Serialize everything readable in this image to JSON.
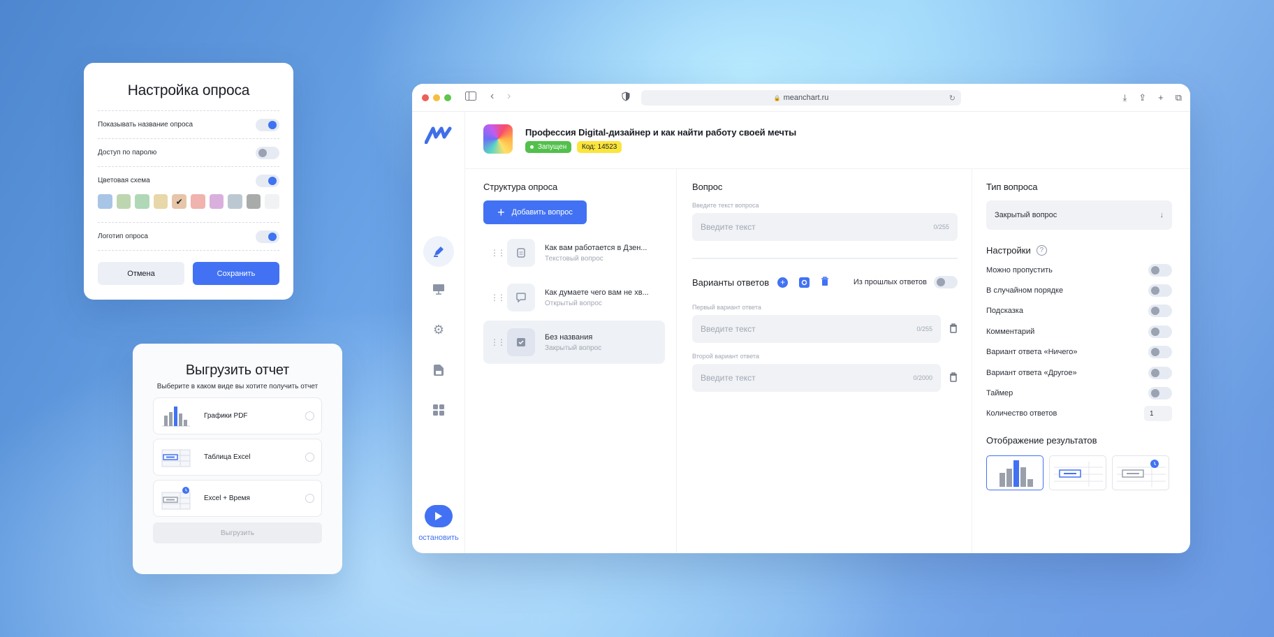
{
  "settings_card": {
    "title": "Настройка опроса",
    "rows": [
      {
        "label": "Показывать название опроса",
        "on": true
      },
      {
        "label": "Доступ по паролю",
        "on": false
      },
      {
        "label": "Цветовая схема",
        "on": true
      }
    ],
    "colors": [
      "#a8c5e6",
      "#bdd6b0",
      "#b0d8b7",
      "#e8d7a8",
      "#e6c5a8",
      "#f0b3ad",
      "#d9b0dd",
      "#bcc8d1",
      "#a9abab",
      "#f1f2f4"
    ],
    "selected_color_check": "✔",
    "logo_row": {
      "label": "Логотип опроса",
      "on": true
    },
    "cancel": "Отмена",
    "save": "Сохранить"
  },
  "export_card": {
    "title": "Выгрузить отчет",
    "subtitle": "Выберите в каком виде вы хотите получить отчет",
    "options": [
      "Графики PDF",
      "Таблица Excel",
      "Excel + Время"
    ],
    "download": "Выгрузить"
  },
  "browser": {
    "url": "meanchart.ru"
  },
  "survey": {
    "title": "Профессия Digital-дизайнер и как найти работу своей мечты",
    "status": "Запущен",
    "code": "Код: 14523",
    "stop": "остановить"
  },
  "structure": {
    "heading": "Структура опроса",
    "add_button": "Добавить вопрос",
    "questions": [
      {
        "title": "Как вам работается в Дзен...",
        "type": "Текстовый вопрос"
      },
      {
        "title": "Как думаете чего вам не хв...",
        "type": "Открытый вопрос"
      },
      {
        "title": "Без названия",
        "type": "Закрытый вопрос"
      }
    ]
  },
  "question": {
    "heading": "Вопрос",
    "field_label": "Введите текст вопроса",
    "placeholder": "Введите текст",
    "counter": "0/255",
    "answers_heading": "Варианты ответов",
    "from_past": "Из прошлых ответов",
    "answers": [
      {
        "label": "Первый вариант ответа",
        "placeholder": "Введите текст",
        "counter": "0/255"
      },
      {
        "label": "Второй вариант ответа",
        "placeholder": "Введите текст",
        "counter": "0/2000"
      }
    ]
  },
  "type_panel": {
    "heading": "Тип вопроса",
    "selected": "Закрытый вопрос",
    "settings_heading": "Настройки",
    "settings": [
      "Можно пропустить",
      "В случайном порядке",
      "Подсказка",
      "Комментарий",
      "Вариант ответа «Ничего»",
      "Вариант ответа «Другое»",
      "Таймер"
    ],
    "answers_count_label": "Количество ответов",
    "answers_count": "1",
    "results_heading": "Отображение результатов"
  }
}
